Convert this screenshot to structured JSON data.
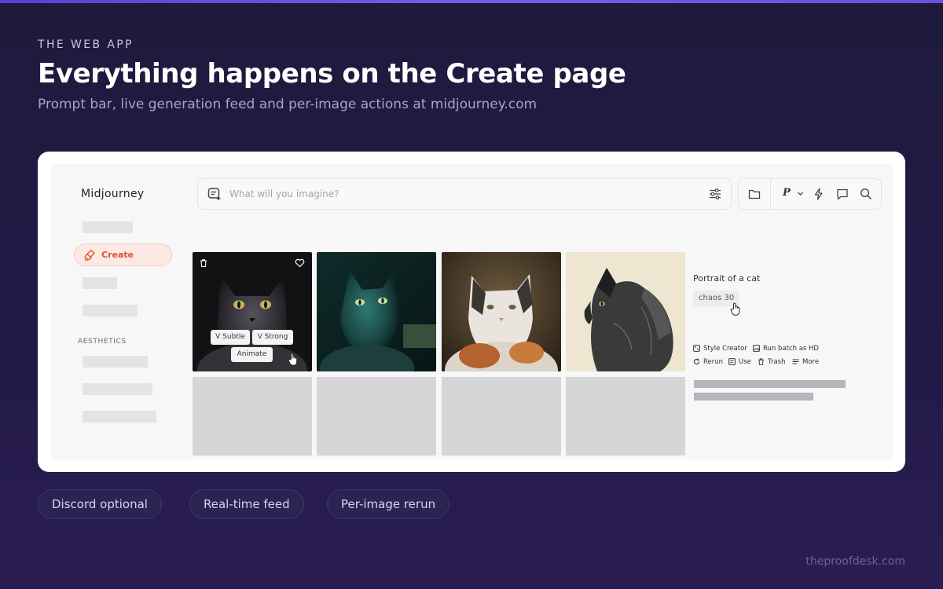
{
  "slide": {
    "eyebrow": "THE WEB APP",
    "title": "Everything happens on the Create page",
    "subtitle": "Prompt bar, live generation feed and per-image actions at midjourney.com"
  },
  "app": {
    "brand": "Midjourney",
    "search": {
      "placeholder": "What will you imagine?"
    },
    "toolbar": {
      "profile_letter": "P"
    },
    "sidebar": {
      "create_label": "Create",
      "section_heading": "AESTHETICS"
    },
    "tile_actions": {
      "vary_subtle": "V Subtle",
      "vary_strong": "V Strong",
      "animate": "Animate"
    },
    "detail": {
      "prompt": "Portrait of a cat",
      "tag": "chaos 30",
      "actions": {
        "style_creator": "Style Creator",
        "run_batch_hd": "Run batch as HD",
        "rerun": "Rerun",
        "use": "Use",
        "trash": "Trash",
        "more": "More"
      }
    }
  },
  "pills": [
    "Discord optional",
    "Real-time feed",
    "Per-image rerun"
  ],
  "footer": "theproofdesk.com",
  "colors": {
    "accent": "#e0502e",
    "background": "#1e1a3d",
    "card": "#ffffff"
  }
}
